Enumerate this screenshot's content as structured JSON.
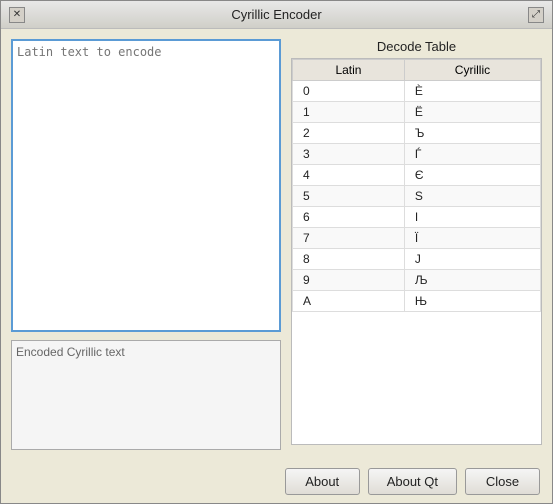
{
  "window": {
    "title": "Cyrillic Encoder"
  },
  "titlebar": {
    "close_icon": "✕",
    "maximize_icon": "⤢"
  },
  "input_area": {
    "placeholder": "Latin text to encode"
  },
  "output_area": {
    "placeholder": "Encoded Cyrillic text"
  },
  "decode_table": {
    "title": "Decode Table",
    "col_latin": "Latin",
    "col_cyrillic": "Cyrillic",
    "rows": [
      {
        "latin": "0",
        "cyrillic": "È"
      },
      {
        "latin": "1",
        "cyrillic": "Ë"
      },
      {
        "latin": "2",
        "cyrillic": "Ъ"
      },
      {
        "latin": "3",
        "cyrillic": "Ѓ"
      },
      {
        "latin": "4",
        "cyrillic": "Є"
      },
      {
        "latin": "5",
        "cyrillic": "Ѕ"
      },
      {
        "latin": "6",
        "cyrillic": "І"
      },
      {
        "latin": "7",
        "cyrillic": "Ї"
      },
      {
        "latin": "8",
        "cyrillic": "Ј"
      },
      {
        "latin": "9",
        "cyrillic": "Љ"
      },
      {
        "latin": "A",
        "cyrillic": "Њ"
      }
    ]
  },
  "footer": {
    "about_label": "About",
    "about_qt_label": "About Qt",
    "close_label": "Close"
  }
}
